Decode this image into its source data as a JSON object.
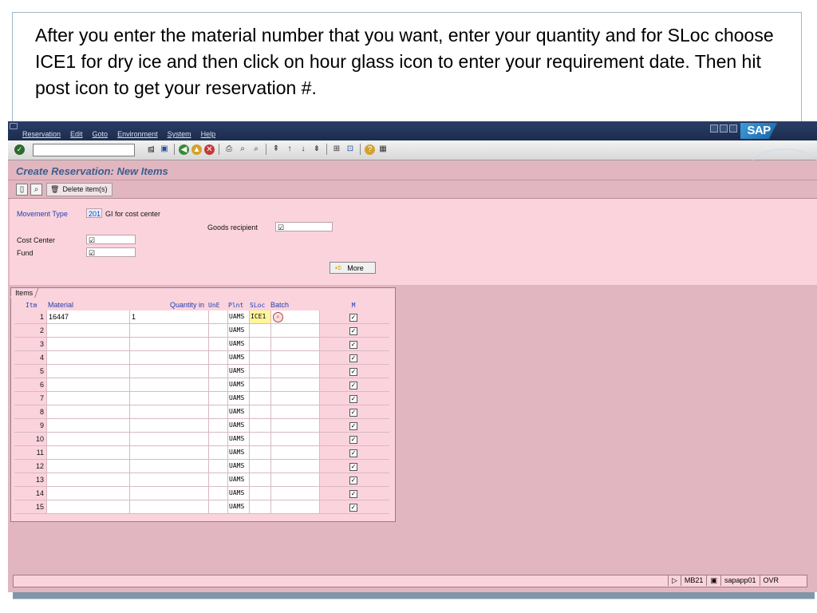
{
  "caption": {
    "text": "After you enter the material number that you want, enter your quantity and for SLoc choose ICE1 for dry ice and then click on hour glass icon to enter your requirement date.  Then hit post icon to get your reservation #."
  },
  "menubar": {
    "items": [
      "Reservation",
      "Edit",
      "Goto",
      "Environment",
      "System",
      "Help"
    ],
    "logo": "SAP"
  },
  "screen": {
    "title": "Create Reservation: New Items",
    "delete_button_label": "Delete item(s)"
  },
  "header": {
    "movement_type_label": "Movement Type",
    "movement_type_value": "201",
    "movement_type_desc": "GI for cost center",
    "goods_recipient_label": "Goods recipient",
    "cost_center_label": "Cost Center",
    "fund_label": "Fund",
    "required_mark": "☑",
    "more_label": "More"
  },
  "items": {
    "tab_label": "Items",
    "columns": {
      "itm": "Itm",
      "material": "Material",
      "quantity": "Quantity in",
      "une": "UnE",
      "plnt": "Plnt",
      "sloc": "SLoc",
      "batch": "Batch",
      "m": "M"
    },
    "rows": [
      {
        "itm": "1",
        "material": "16447",
        "quantity": "1",
        "plnt": "UAMS",
        "sloc": "ICE1",
        "m": true
      },
      {
        "itm": "2",
        "material": "",
        "quantity": "",
        "plnt": "UAMS",
        "sloc": "",
        "m": true
      },
      {
        "itm": "3",
        "material": "",
        "quantity": "",
        "plnt": "UAMS",
        "sloc": "",
        "m": true
      },
      {
        "itm": "4",
        "material": "",
        "quantity": "",
        "plnt": "UAMS",
        "sloc": "",
        "m": true
      },
      {
        "itm": "5",
        "material": "",
        "quantity": "",
        "plnt": "UAMS",
        "sloc": "",
        "m": true
      },
      {
        "itm": "6",
        "material": "",
        "quantity": "",
        "plnt": "UAMS",
        "sloc": "",
        "m": true
      },
      {
        "itm": "7",
        "material": "",
        "quantity": "",
        "plnt": "UAMS",
        "sloc": "",
        "m": true
      },
      {
        "itm": "8",
        "material": "",
        "quantity": "",
        "plnt": "UAMS",
        "sloc": "",
        "m": true
      },
      {
        "itm": "9",
        "material": "",
        "quantity": "",
        "plnt": "UAMS",
        "sloc": "",
        "m": true
      },
      {
        "itm": "10",
        "material": "",
        "quantity": "",
        "plnt": "UAMS",
        "sloc": "",
        "m": true
      },
      {
        "itm": "11",
        "material": "",
        "quantity": "",
        "plnt": "UAMS",
        "sloc": "",
        "m": true
      },
      {
        "itm": "12",
        "material": "",
        "quantity": "",
        "plnt": "UAMS",
        "sloc": "",
        "m": true
      },
      {
        "itm": "13",
        "material": "",
        "quantity": "",
        "plnt": "UAMS",
        "sloc": "",
        "m": true
      },
      {
        "itm": "14",
        "material": "",
        "quantity": "",
        "plnt": "UAMS",
        "sloc": "",
        "m": true
      },
      {
        "itm": "15",
        "material": "",
        "quantity": "",
        "plnt": "UAMS",
        "sloc": "",
        "m": true
      }
    ]
  },
  "status": {
    "transaction": "MB21",
    "server": "sapapp01",
    "mode": "OVR"
  },
  "colors": {
    "background": "#e2b6c0",
    "panel": "#fbd3dd",
    "label_blue": "#1f3fb0",
    "title_blue": "#3a5f8f",
    "sloc_highlight": "#fff59a"
  }
}
